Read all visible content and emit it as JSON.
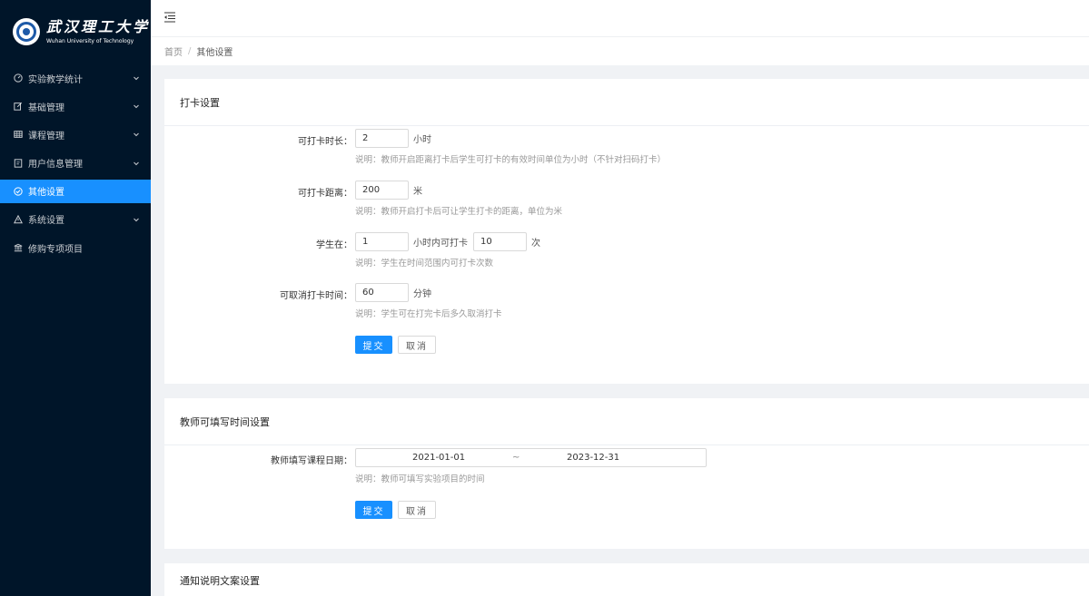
{
  "logo": {
    "cn": "武汉理工大学",
    "en": "Wuhan University of Technology"
  },
  "sidebar": {
    "items": [
      {
        "label": "实验教学统计",
        "icon": "dashboard-icon",
        "has_children": true,
        "active": false
      },
      {
        "label": "基础管理",
        "icon": "edit-icon",
        "has_children": true,
        "active": false
      },
      {
        "label": "课程管理",
        "icon": "table-icon",
        "has_children": true,
        "active": false
      },
      {
        "label": "用户信息管理",
        "icon": "profile-icon",
        "has_children": true,
        "active": false
      },
      {
        "label": "其他设置",
        "icon": "check-circle-icon",
        "has_children": false,
        "active": true
      },
      {
        "label": "系统设置",
        "icon": "warning-icon",
        "has_children": true,
        "active": false
      },
      {
        "label": "修购专项项目",
        "icon": "bank-icon",
        "has_children": false,
        "active": false
      }
    ]
  },
  "breadcrumb": {
    "home": "首页",
    "separator": "/",
    "current": "其他设置"
  },
  "checkin_card": {
    "title": "打卡设置",
    "duration": {
      "label": "可打卡时长：",
      "value": "2",
      "unit": "小时",
      "desc": "说明：教师开启距离打卡后学生可打卡的有效时间单位为小时（不针对扫码打卡）"
    },
    "distance": {
      "label": "可打卡距离：",
      "value": "200",
      "unit": "米",
      "desc": "说明：教师开启打卡后可让学生打卡的距离，单位为米"
    },
    "frequency": {
      "label": "学生在：",
      "value_hours": "1",
      "mid_text": "小时内可打卡",
      "value_times": "10",
      "unit": "次",
      "desc": "说明：学生在时间范围内可打卡次数"
    },
    "cancel_time": {
      "label": "可取消打卡时间：",
      "value": "60",
      "unit": "分钟",
      "desc": "说明：学生可在打完卡后多久取消打卡"
    },
    "submit_label": "提交",
    "cancel_label": "取消"
  },
  "teacher_card": {
    "title": "教师可填写时间设置",
    "date_label": "教师填写课程日期：",
    "start_date": "2021-01-01",
    "range_sep": "~",
    "end_date": "2023-12-31",
    "desc": "说明：教师可填写实验项目的时间",
    "submit_label": "提交",
    "cancel_label": "取消"
  },
  "notice_card": {
    "title": "通知说明文案设置"
  },
  "colors": {
    "sidebar_bg": "#001529",
    "primary": "#1890ff",
    "page_bg": "#f0f2f5"
  }
}
